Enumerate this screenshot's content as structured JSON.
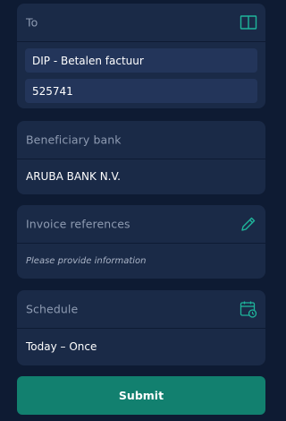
{
  "to": {
    "label": "To",
    "icon": "book-icon",
    "name_value": "DIP - Betalen factuur",
    "account_value": "525741"
  },
  "beneficiary": {
    "label": "Beneficiary bank",
    "value": "ARUBA BANK N.V."
  },
  "invoice": {
    "label": "Invoice references",
    "icon": "pencil-icon",
    "placeholder": "Please provide information"
  },
  "schedule": {
    "label": "Schedule",
    "icon": "calendar-clock-icon",
    "value": "Today – Once"
  },
  "submit": {
    "label": "Submit"
  },
  "colors": {
    "background": "#0e1b33",
    "card": "#1a2a47",
    "field": "#23355a",
    "accent_icon": "#1fb59b",
    "submit_button": "#12806f",
    "label_text": "#8e9bb2",
    "value_text": "#ffffff"
  }
}
